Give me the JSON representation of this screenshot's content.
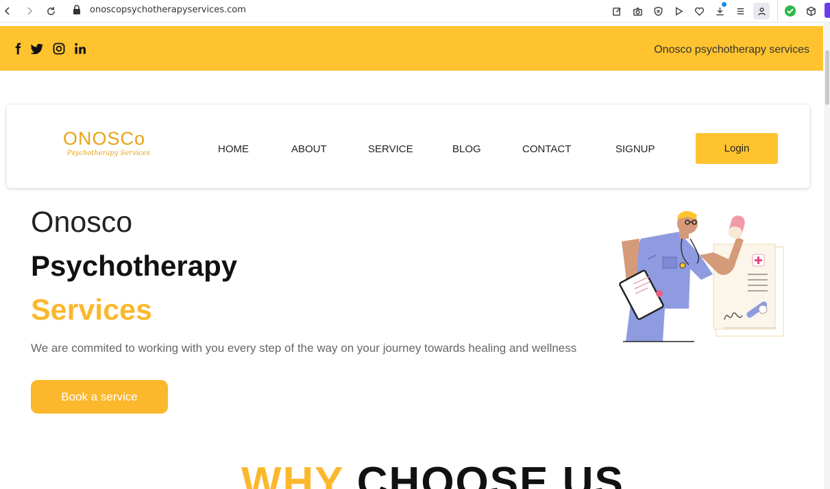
{
  "browser": {
    "url": "onoscopsychotherapyservices.com",
    "icons": [
      "back-icon",
      "forward-icon",
      "reload-icon",
      "lock-icon",
      "edit-icon",
      "camera-icon",
      "shield-icon",
      "play-icon",
      "heart-icon",
      "download-icon",
      "tabs-menu-icon",
      "profile-icon",
      "check-extension-icon",
      "cube-icon"
    ]
  },
  "topbar": {
    "social": [
      "facebook-icon",
      "twitter-icon",
      "instagram-icon",
      "linkedin-icon"
    ],
    "tagline": "Onosco psychotherapy services"
  },
  "nav": {
    "logo_main": "ONOSCo",
    "logo_sub": "Psychotherapy Services",
    "items": [
      "HOME",
      "ABOUT",
      "SERVICE",
      "BLOG",
      "CONTACT",
      "SIGNUP"
    ],
    "login": "Login"
  },
  "hero": {
    "line1": "Onosco",
    "line2": "Psychotherapy",
    "line3": "Services",
    "description": "We are commited to working with you every step of the way on your journey towards healing and wellness",
    "cta": "Book a service"
  },
  "section": {
    "why_part1": "WHY",
    "why_part2": "CHOOSE US"
  },
  "colors": {
    "accent": "#fec32f",
    "accent_text": "#fbb82d",
    "logo": "#e6a313"
  }
}
